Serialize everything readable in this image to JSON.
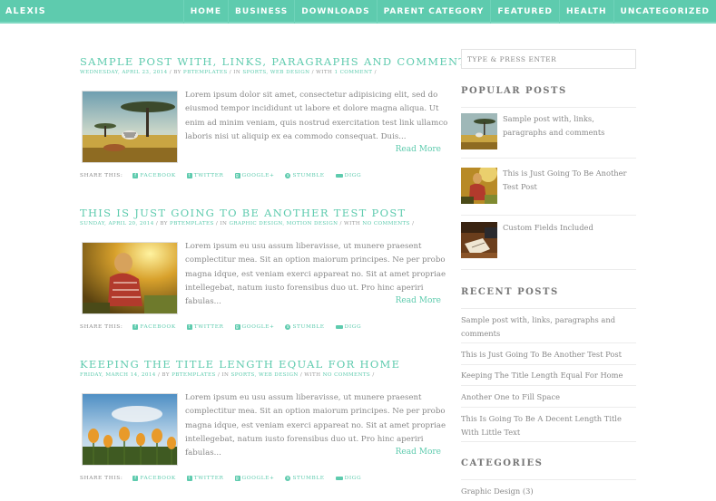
{
  "header": {
    "brand": "ALEXIS",
    "nav": [
      "HOME",
      "BUSINESS",
      "DOWNLOADS",
      "PARENT CATEGORY",
      "FEATURED",
      "HEALTH",
      "UNCATEGORIZED"
    ]
  },
  "colors": {
    "accent": "#5ecbae",
    "text": "#888888"
  },
  "posts": [
    {
      "title": "SAMPLE POST WITH, LINKS, PARAGRAPHS AND COMMENTS",
      "date": "WEDNESDAY, APRIL 23, 2014",
      "by_label": " / BY ",
      "author": "PBTEMPLATES",
      "in_label": " / IN ",
      "categories": [
        "SPORTS",
        "WEB DESIGN"
      ],
      "with_label": " / WITH ",
      "comments": "1 COMMENT",
      "end": " /",
      "image": "savanna-zebra-thumbnail",
      "excerpt": "Lorem ipsum dolor sit amet, consectetur adipisicing elit, sed do eiusmod tempor incididunt ut labore et dolore magna aliqua. Ut enim ad minim veniam, quis nostrud exercitation test link ullamco laboris nisi ut aliquip ex ea commodo consequat. Duis...",
      "read_more": "Read More"
    },
    {
      "title": "THIS IS JUST GOING TO BE ANOTHER TEST POST",
      "date": "SUNDAY, APRIL 20, 2014",
      "by_label": " / BY ",
      "author": "PBTEMPLATES",
      "in_label": " / IN ",
      "categories": [
        "GRAPHIC DESIGN",
        "MOTION DESIGN"
      ],
      "with_label": " / WITH ",
      "comments": "NO COMMENTS",
      "end": " /",
      "image": "girl-sunlight-thumbnail",
      "excerpt": "Lorem ipsum eu usu assum liberavisse, ut munere praesent complectitur mea. Sit an option maiorum principes. Ne per probo magna idque, est veniam exerci appareat no. Sit at amet propriae intellegebat, natum iusto forensibus duo ut. Pro hinc aperiri fabulas...",
      "read_more": "Read More"
    },
    {
      "title": "KEEPING THE TITLE LENGTH EQUAL FOR HOME",
      "date": "FRIDAY, MARCH 14, 2014",
      "by_label": " / BY ",
      "author": "PBTEMPLATES",
      "in_label": " / IN ",
      "categories": [
        "SPORTS",
        "WEB DESIGN"
      ],
      "with_label": " / WITH ",
      "comments": "NO COMMENTS",
      "end": " /",
      "image": "tulips-thumbnail",
      "excerpt": "Lorem ipsum eu usu assum liberavisse, ut munere praesent complectitur mea. Sit an option maiorum principes. Ne per probo magna idque, est veniam exerci appareat no. Sit at amet propriae intellegebat, natum iusto forensibus duo ut. Pro hinc aperiri fabulas...",
      "read_more": "Read More"
    }
  ],
  "share": {
    "label": "SHARE THIS:",
    "links": [
      {
        "label": "FACEBOOK",
        "icon": "facebook-icon",
        "glyph": "f"
      },
      {
        "label": "TWITTER",
        "icon": "twitter-icon",
        "glyph": "t"
      },
      {
        "label": "GOOGLE+",
        "icon": "google-plus-icon",
        "glyph": "g"
      },
      {
        "label": "STUMBLE",
        "icon": "stumbleupon-icon",
        "glyph": "s"
      },
      {
        "label": "DIGG",
        "icon": "digg-icon",
        "glyph": ""
      }
    ]
  },
  "sidebar": {
    "search_placeholder": "TYPE & PRESS ENTER",
    "popular_title": "POPULAR POSTS",
    "popular": [
      {
        "title": "Sample post with, links, paragraphs and comments",
        "image": "savanna-zebra-thumbnail"
      },
      {
        "title": "This is Just Going To Be Another Test Post",
        "image": "girl-sunlight-thumbnail"
      },
      {
        "title": "Custom Fields Included",
        "image": "desk-notebook-thumbnail"
      }
    ],
    "recent_title": "RECENT POSTS",
    "recent": [
      "Sample post with, links, paragraphs and comments",
      "This is Just Going To Be Another Test Post",
      "Keeping The Title Length Equal For Home",
      "Another One to Fill Space",
      "This Is Going To Be A Decent Length Title With Little Text"
    ],
    "categories_title": "CATEGORIES",
    "categories": [
      "Graphic Design (3)"
    ]
  }
}
